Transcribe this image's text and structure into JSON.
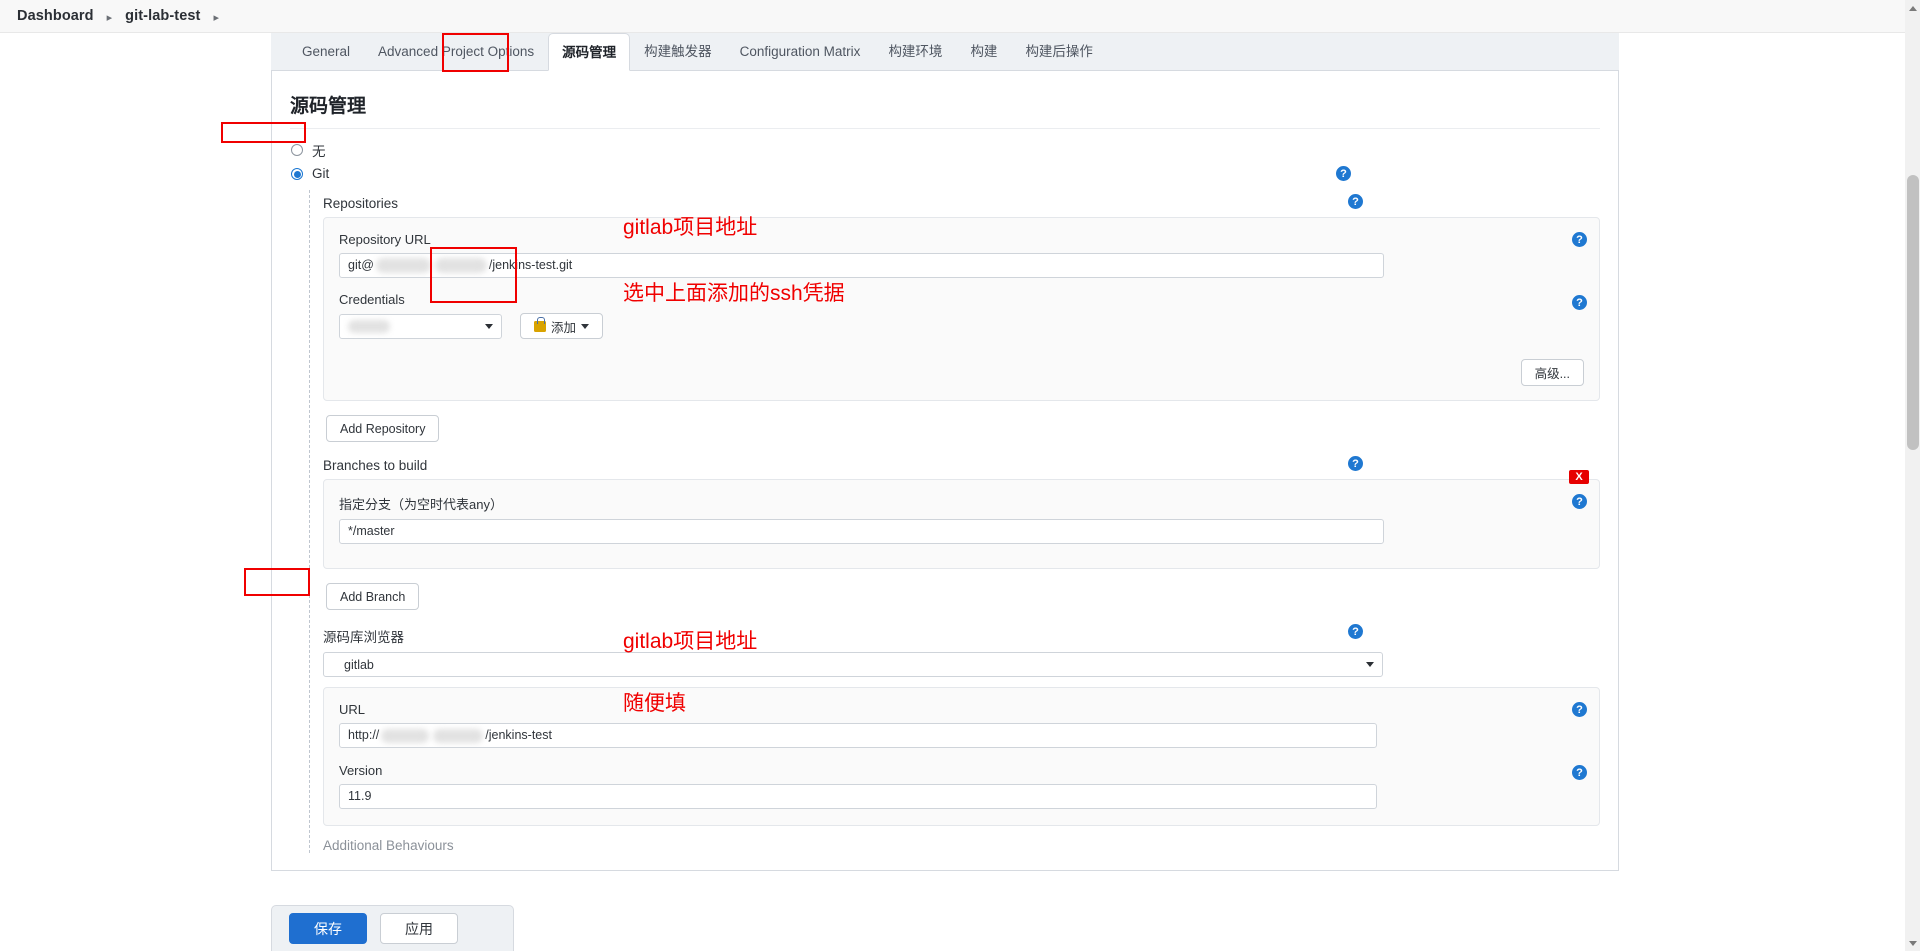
{
  "breadcrumb": {
    "items": [
      "Dashboard",
      "git-lab-test"
    ],
    "separator": "▸"
  },
  "tabs": [
    {
      "label": "General",
      "active": false
    },
    {
      "label": "Advanced Project Options",
      "active": false
    },
    {
      "label": "源码管理",
      "active": true
    },
    {
      "label": "构建触发器",
      "active": false
    },
    {
      "label": "Configuration Matrix",
      "active": false
    },
    {
      "label": "构建环境",
      "active": false
    },
    {
      "label": "构建",
      "active": false
    },
    {
      "label": "构建后操作",
      "active": false
    }
  ],
  "section": {
    "title": "源码管理"
  },
  "scm_radio": {
    "none_label": "无",
    "git_label": "Git",
    "selected": "Git"
  },
  "repositories": {
    "label": "Repositories",
    "repository_url_label": "Repository URL",
    "repository_url_value_prefix": "git@",
    "repository_url_value_suffix": "/jenkins-test.git",
    "credentials_label": "Credentials",
    "credentials_value": "",
    "add_credentials_button": "添加",
    "advanced_button": "高级...",
    "add_repository_button": "Add Repository"
  },
  "branches": {
    "label": "Branches to build",
    "branch_specifier_label": "指定分支（为空时代表any）",
    "branch_specifier_value": "*/master",
    "add_branch_button": "Add Branch",
    "delete_badge": "X"
  },
  "browser": {
    "label": "源码库浏览器",
    "selected": "gitlab",
    "url_label": "URL",
    "url_value_prefix": "http://",
    "url_value_suffix": "/jenkins-test",
    "version_label": "Version",
    "version_value": "11.9"
  },
  "additional_behaviours": {
    "label": "Additional Behaviours"
  },
  "footer": {
    "save_label": "保存",
    "apply_label": "应用"
  },
  "annotations": [
    {
      "id": "anno-repo-url",
      "text": "gitlab项目地址"
    },
    {
      "id": "anno-credentials",
      "text": "选中上面添加的ssh凭据"
    },
    {
      "id": "anno-browser-url",
      "text": "gitlab项目地址"
    },
    {
      "id": "anno-version",
      "text": "随便填"
    }
  ],
  "help_icon": {
    "glyph": "?"
  },
  "colors": {
    "accent_blue": "#1f78d1",
    "annotation_red": "#f00000",
    "tab_bar_bg": "#eef1f4",
    "primary_button": "#1f6fd0"
  }
}
